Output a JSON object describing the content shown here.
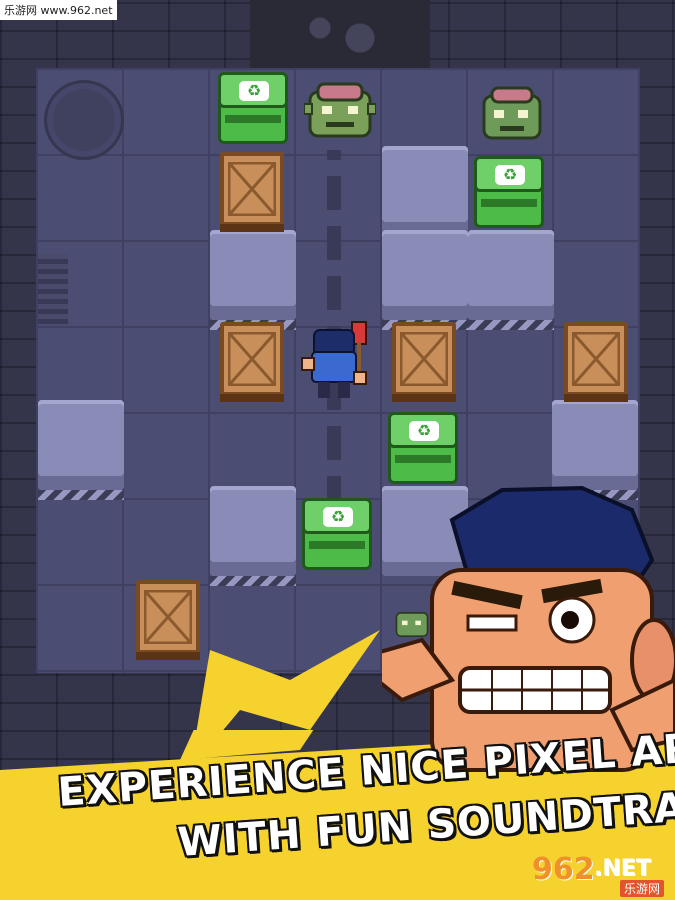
{
  "watermark_top": "乐游网 www.962.net",
  "headline": {
    "line1": "EXPERIENCE NICE PIXEL ART",
    "line2": "WITH FUN SOUNDTRACK"
  },
  "watermark_logo": {
    "digits": "962",
    "suffix": ".NET",
    "sub": "乐游网"
  },
  "icons": {
    "recycle": "♻",
    "crate": "crate-icon"
  },
  "colors": {
    "banner_yellow": "#f5d22e",
    "bin_green": "#4cbb48",
    "crate_brown": "#c98f5a",
    "stone": "#8a8cb8"
  }
}
